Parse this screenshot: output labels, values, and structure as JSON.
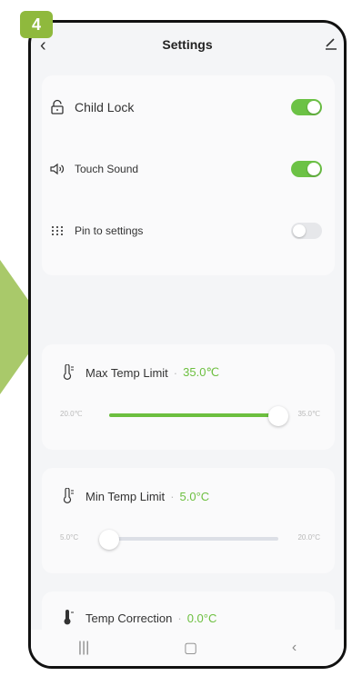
{
  "step": {
    "number": "4"
  },
  "header": {
    "back_icon": "chevron-left-icon",
    "title": "Settings",
    "edit_icon": "pencil-icon"
  },
  "toggles": [
    {
      "icon": "lock-icon",
      "label": "Child Lock",
      "state": "on"
    },
    {
      "icon": "speaker-icon",
      "label": "Touch Sound",
      "state": "on"
    },
    {
      "icon": "pin-icon",
      "label": "Pin to settings",
      "state": "off"
    }
  ],
  "max_limit": {
    "icon": "thermometer-icon",
    "label": "Max Temp Limit",
    "separator": "·",
    "value": "35.0℃",
    "range_min": "20.0℃",
    "range_max": "35.0℃",
    "position": 1.0
  },
  "min_limit": {
    "icon": "thermometer-icon",
    "label": "Min Temp Limit",
    "separator": "·",
    "value": "5.0°C",
    "range_min": "5.0°C",
    "range_max": "20.0°C",
    "position": 0.0
  },
  "correction": {
    "icon": "thermometer-solid-icon",
    "label": "Temp Correction",
    "separator": "·",
    "value": "0.0°C"
  },
  "navbar": {
    "recent": "|||",
    "home": "▢",
    "back": "‹"
  },
  "colors": {
    "accent": "#6cc245",
    "badge": "#8fb93d",
    "arrow": "#a9c96a"
  }
}
